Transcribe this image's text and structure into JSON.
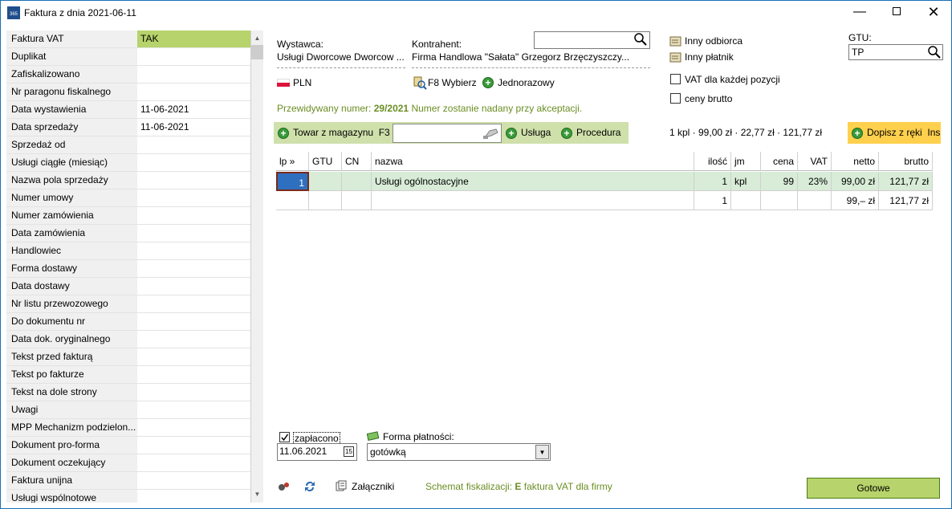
{
  "window": {
    "title": "Faktura z dnia 2021-06-11",
    "icon_text": "365"
  },
  "properties": [
    {
      "label": "Faktura VAT",
      "value": "TAK",
      "selected": true
    },
    {
      "label": "Duplikat",
      "value": ""
    },
    {
      "label": "Zafiskalizowano",
      "value": ""
    },
    {
      "label": "Nr paragonu fiskalnego",
      "value": ""
    },
    {
      "label": "Data wystawienia",
      "value": "11-06-2021"
    },
    {
      "label": "Data sprzedaży",
      "value": "11-06-2021"
    },
    {
      "label": "Sprzedaż od",
      "value": ""
    },
    {
      "label": "Usługi ciągłe (miesiąc)",
      "value": ""
    },
    {
      "label": "Nazwa pola sprzedaży",
      "value": ""
    },
    {
      "label": "Numer umowy",
      "value": ""
    },
    {
      "label": "Numer zamówienia",
      "value": ""
    },
    {
      "label": "Data zamówienia",
      "value": ""
    },
    {
      "label": "Handlowiec",
      "value": ""
    },
    {
      "label": "Forma dostawy",
      "value": ""
    },
    {
      "label": "Data dostawy",
      "value": ""
    },
    {
      "label": "Nr listu przewozowego",
      "value": ""
    },
    {
      "label": "Do dokumentu nr",
      "value": ""
    },
    {
      "label": "Data dok. oryginalnego",
      "value": ""
    },
    {
      "label": "Tekst przed fakturą",
      "value": ""
    },
    {
      "label": "Tekst po fakturze",
      "value": ""
    },
    {
      "label": "Tekst na dole strony",
      "value": ""
    },
    {
      "label": "Uwagi",
      "value": ""
    },
    {
      "label": "MPP Mechanizm podzielon...",
      "value": ""
    },
    {
      "label": "Dokument pro-forma",
      "value": ""
    },
    {
      "label": "Dokument oczekujący",
      "value": ""
    },
    {
      "label": "Faktura unijna",
      "value": ""
    },
    {
      "label": "Usługi wspólnotowe",
      "value": ""
    }
  ],
  "header": {
    "wystawca_label": "Wystawca:",
    "wystawca_value": "Usługi Dworcowe Dworcow ...",
    "kontrahent_label": "Kontrahent:",
    "kontrahent_value": "Firma Handlowa \"Sałata\" Grzegorz Brzęczyszczy...",
    "search_value": "",
    "currency": "PLN",
    "f8_label": "F8 Wybierz",
    "jednorazowy_label": "Jednorazowy",
    "inny_odbiorca": "Inny odbiorca",
    "inny_platnik": "Inny płatnik",
    "vat_checkbox": "VAT dla każdej pozycji",
    "brutto_checkbox": "ceny brutto",
    "gtu_label": "GTU:",
    "gtu_value": "TP",
    "predicted_prefix": "Przewidywany numer:",
    "predicted_number": "29/2021",
    "predicted_suffix": "Numer zostanie nadany przy akceptacji."
  },
  "toolbar": {
    "towar_label": "Towar z magazynu",
    "towar_shortcut": "F3",
    "usluga_label": "Usługa",
    "procedura_label": "Procedura",
    "summary": "1 kpl · 99,00 zł · 22,77 zł · 121,77 zł",
    "dopisz_label": "Dopisz z ręki",
    "dopisz_shortcut": "Ins"
  },
  "grid": {
    "columns": [
      "lp »",
      "GTU",
      "CN",
      "nazwa",
      "ilość",
      "jm",
      "cena",
      "VAT",
      "netto",
      "brutto"
    ],
    "rows": [
      [
        "1",
        "",
        "",
        "Usługi ogólnostacyjne",
        "1",
        "kpl",
        "99",
        "23%",
        "99,00 zł",
        "121,77 zł"
      ]
    ],
    "totals": [
      "",
      "",
      "",
      "",
      "1",
      "",
      "",
      "",
      "99,– zł",
      "121,77 zł"
    ]
  },
  "footer": {
    "zaplacono_label": "zapłacono",
    "date_value": "11.06.2021",
    "calendar_icon_text": "15",
    "forma_label": "Forma płatności:",
    "forma_value": "gotówką",
    "zalaczniki_label": "Załączniki",
    "schemat_prefix": "Schemat fiskalizacji:",
    "schemat_code": "E",
    "schemat_suffix": "faktura VAT dla firmy",
    "gotowe_label": "Gotowe"
  },
  "colors": {
    "selected_value": "#b7d36b",
    "toolbar_green": "#cfe0ab",
    "dopisz_yellow": "#ffd04d",
    "row_highlight": "#d8ecd8",
    "olive_text": "#6b8e23"
  }
}
